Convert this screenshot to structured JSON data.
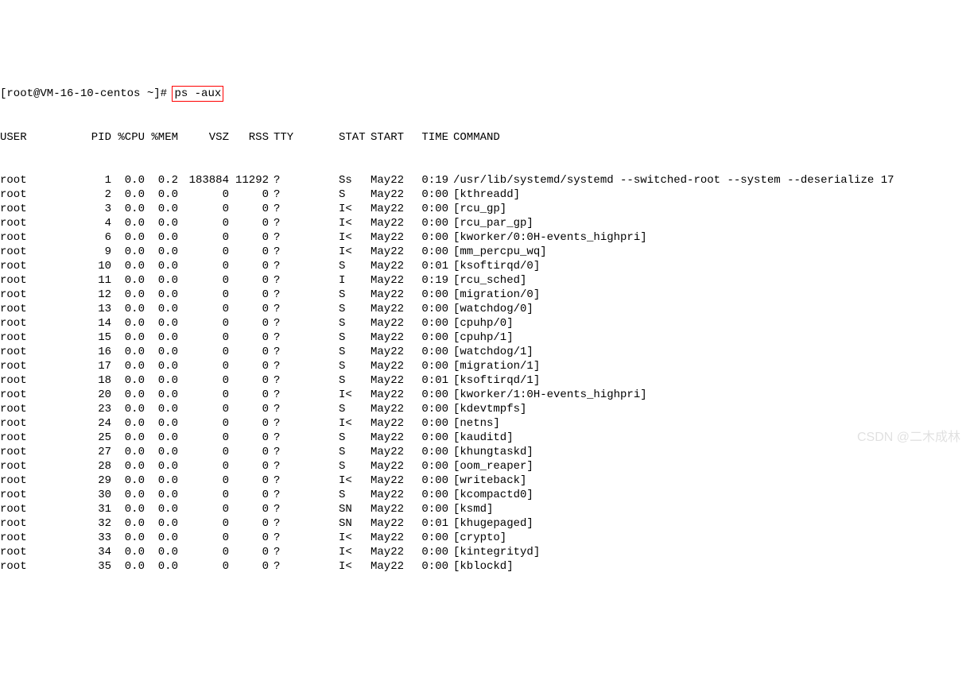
{
  "prompt": {
    "user_host": "[root@VM-16-10-centos ~]#",
    "command": "ps -aux"
  },
  "headers": {
    "user": "USER",
    "pid": "PID",
    "cpu": "%CPU",
    "mem": "%MEM",
    "vsz": "VSZ",
    "rss": "RSS",
    "tty": "TTY",
    "stat": "STAT",
    "start": "START",
    "time": "TIME",
    "command": "COMMAND"
  },
  "rows": [
    {
      "user": "root",
      "pid": "1",
      "cpu": "0.0",
      "mem": "0.2",
      "vsz": "183884",
      "rss": "11292",
      "tty": "?",
      "stat": "Ss",
      "start": "May22",
      "time": "0:19",
      "command": "/usr/lib/systemd/systemd --switched-root --system --deserialize 17"
    },
    {
      "user": "root",
      "pid": "2",
      "cpu": "0.0",
      "mem": "0.0",
      "vsz": "0",
      "rss": "0",
      "tty": "?",
      "stat": "S",
      "start": "May22",
      "time": "0:00",
      "command": "[kthreadd]"
    },
    {
      "user": "root",
      "pid": "3",
      "cpu": "0.0",
      "mem": "0.0",
      "vsz": "0",
      "rss": "0",
      "tty": "?",
      "stat": "I<",
      "start": "May22",
      "time": "0:00",
      "command": "[rcu_gp]"
    },
    {
      "user": "root",
      "pid": "4",
      "cpu": "0.0",
      "mem": "0.0",
      "vsz": "0",
      "rss": "0",
      "tty": "?",
      "stat": "I<",
      "start": "May22",
      "time": "0:00",
      "command": "[rcu_par_gp]"
    },
    {
      "user": "root",
      "pid": "6",
      "cpu": "0.0",
      "mem": "0.0",
      "vsz": "0",
      "rss": "0",
      "tty": "?",
      "stat": "I<",
      "start": "May22",
      "time": "0:00",
      "command": "[kworker/0:0H-events_highpri]"
    },
    {
      "user": "root",
      "pid": "9",
      "cpu": "0.0",
      "mem": "0.0",
      "vsz": "0",
      "rss": "0",
      "tty": "?",
      "stat": "I<",
      "start": "May22",
      "time": "0:00",
      "command": "[mm_percpu_wq]"
    },
    {
      "user": "root",
      "pid": "10",
      "cpu": "0.0",
      "mem": "0.0",
      "vsz": "0",
      "rss": "0",
      "tty": "?",
      "stat": "S",
      "start": "May22",
      "time": "0:01",
      "command": "[ksoftirqd/0]"
    },
    {
      "user": "root",
      "pid": "11",
      "cpu": "0.0",
      "mem": "0.0",
      "vsz": "0",
      "rss": "0",
      "tty": "?",
      "stat": "I",
      "start": "May22",
      "time": "0:19",
      "command": "[rcu_sched]"
    },
    {
      "user": "root",
      "pid": "12",
      "cpu": "0.0",
      "mem": "0.0",
      "vsz": "0",
      "rss": "0",
      "tty": "?",
      "stat": "S",
      "start": "May22",
      "time": "0:00",
      "command": "[migration/0]"
    },
    {
      "user": "root",
      "pid": "13",
      "cpu": "0.0",
      "mem": "0.0",
      "vsz": "0",
      "rss": "0",
      "tty": "?",
      "stat": "S",
      "start": "May22",
      "time": "0:00",
      "command": "[watchdog/0]"
    },
    {
      "user": "root",
      "pid": "14",
      "cpu": "0.0",
      "mem": "0.0",
      "vsz": "0",
      "rss": "0",
      "tty": "?",
      "stat": "S",
      "start": "May22",
      "time": "0:00",
      "command": "[cpuhp/0]"
    },
    {
      "user": "root",
      "pid": "15",
      "cpu": "0.0",
      "mem": "0.0",
      "vsz": "0",
      "rss": "0",
      "tty": "?",
      "stat": "S",
      "start": "May22",
      "time": "0:00",
      "command": "[cpuhp/1]"
    },
    {
      "user": "root",
      "pid": "16",
      "cpu": "0.0",
      "mem": "0.0",
      "vsz": "0",
      "rss": "0",
      "tty": "?",
      "stat": "S",
      "start": "May22",
      "time": "0:00",
      "command": "[watchdog/1]"
    },
    {
      "user": "root",
      "pid": "17",
      "cpu": "0.0",
      "mem": "0.0",
      "vsz": "0",
      "rss": "0",
      "tty": "?",
      "stat": "S",
      "start": "May22",
      "time": "0:00",
      "command": "[migration/1]"
    },
    {
      "user": "root",
      "pid": "18",
      "cpu": "0.0",
      "mem": "0.0",
      "vsz": "0",
      "rss": "0",
      "tty": "?",
      "stat": "S",
      "start": "May22",
      "time": "0:01",
      "command": "[ksoftirqd/1]"
    },
    {
      "user": "root",
      "pid": "20",
      "cpu": "0.0",
      "mem": "0.0",
      "vsz": "0",
      "rss": "0",
      "tty": "?",
      "stat": "I<",
      "start": "May22",
      "time": "0:00",
      "command": "[kworker/1:0H-events_highpri]"
    },
    {
      "user": "root",
      "pid": "23",
      "cpu": "0.0",
      "mem": "0.0",
      "vsz": "0",
      "rss": "0",
      "tty": "?",
      "stat": "S",
      "start": "May22",
      "time": "0:00",
      "command": "[kdevtmpfs]"
    },
    {
      "user": "root",
      "pid": "24",
      "cpu": "0.0",
      "mem": "0.0",
      "vsz": "0",
      "rss": "0",
      "tty": "?",
      "stat": "I<",
      "start": "May22",
      "time": "0:00",
      "command": "[netns]"
    },
    {
      "user": "root",
      "pid": "25",
      "cpu": "0.0",
      "mem": "0.0",
      "vsz": "0",
      "rss": "0",
      "tty": "?",
      "stat": "S",
      "start": "May22",
      "time": "0:00",
      "command": "[kauditd]"
    },
    {
      "user": "root",
      "pid": "27",
      "cpu": "0.0",
      "mem": "0.0",
      "vsz": "0",
      "rss": "0",
      "tty": "?",
      "stat": "S",
      "start": "May22",
      "time": "0:00",
      "command": "[khungtaskd]"
    },
    {
      "user": "root",
      "pid": "28",
      "cpu": "0.0",
      "mem": "0.0",
      "vsz": "0",
      "rss": "0",
      "tty": "?",
      "stat": "S",
      "start": "May22",
      "time": "0:00",
      "command": "[oom_reaper]"
    },
    {
      "user": "root",
      "pid": "29",
      "cpu": "0.0",
      "mem": "0.0",
      "vsz": "0",
      "rss": "0",
      "tty": "?",
      "stat": "I<",
      "start": "May22",
      "time": "0:00",
      "command": "[writeback]"
    },
    {
      "user": "root",
      "pid": "30",
      "cpu": "0.0",
      "mem": "0.0",
      "vsz": "0",
      "rss": "0",
      "tty": "?",
      "stat": "S",
      "start": "May22",
      "time": "0:00",
      "command": "[kcompactd0]"
    },
    {
      "user": "root",
      "pid": "31",
      "cpu": "0.0",
      "mem": "0.0",
      "vsz": "0",
      "rss": "0",
      "tty": "?",
      "stat": "SN",
      "start": "May22",
      "time": "0:00",
      "command": "[ksmd]"
    },
    {
      "user": "root",
      "pid": "32",
      "cpu": "0.0",
      "mem": "0.0",
      "vsz": "0",
      "rss": "0",
      "tty": "?",
      "stat": "SN",
      "start": "May22",
      "time": "0:01",
      "command": "[khugepaged]"
    },
    {
      "user": "root",
      "pid": "33",
      "cpu": "0.0",
      "mem": "0.0",
      "vsz": "0",
      "rss": "0",
      "tty": "?",
      "stat": "I<",
      "start": "May22",
      "time": "0:00",
      "command": "[crypto]"
    },
    {
      "user": "root",
      "pid": "34",
      "cpu": "0.0",
      "mem": "0.0",
      "vsz": "0",
      "rss": "0",
      "tty": "?",
      "stat": "I<",
      "start": "May22",
      "time": "0:00",
      "command": "[kintegrityd]"
    },
    {
      "user": "root",
      "pid": "35",
      "cpu": "0.0",
      "mem": "0.0",
      "vsz": "0",
      "rss": "0",
      "tty": "?",
      "stat": "I<",
      "start": "May22",
      "time": "0:00",
      "command": "[kblockd]"
    }
  ],
  "watermark": "CSDN @二木成林"
}
